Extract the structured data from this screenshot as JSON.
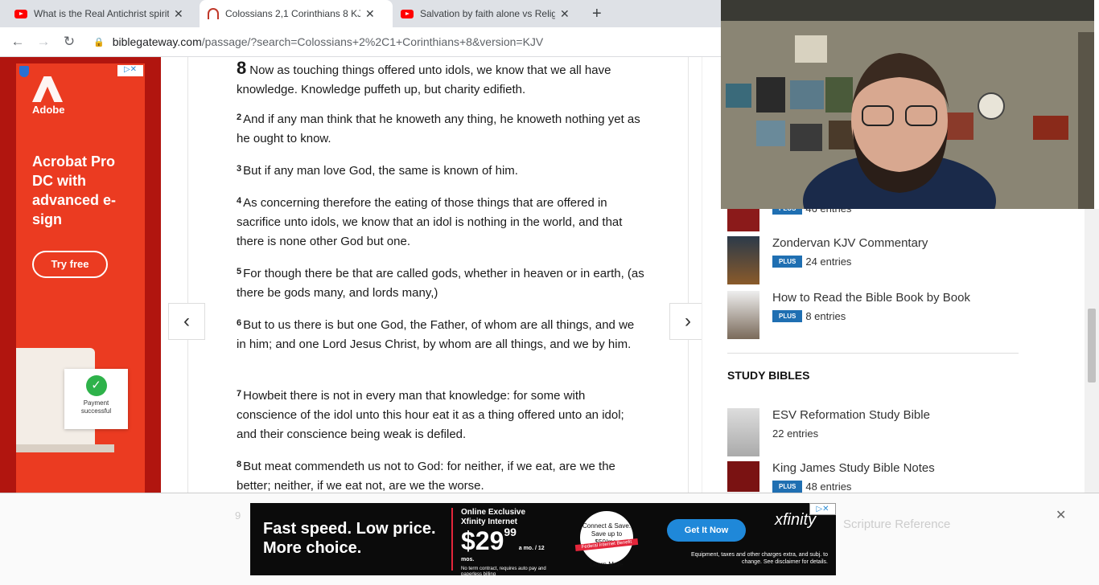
{
  "browser": {
    "tabs": [
      {
        "title": "What is the Real Antichrist spirit",
        "icon": "youtube-icon",
        "active": false
      },
      {
        "title": "Colossians 2,1 Corinthians 8 KJV",
        "icon": "biblegateway-icon",
        "active": true
      },
      {
        "title": "Salvation by faith alone vs Religi",
        "icon": "youtube-icon",
        "active": false
      }
    ],
    "url_host": "biblegateway.com",
    "url_path": "/passage/?search=Colossians+2%2C1+Corinthians+8&version=KJV"
  },
  "left_ad": {
    "brand": "Adobe",
    "headline": "Acrobat Pro DC with advanced e-sign",
    "cta": "Try free",
    "card_text": "Payment successful",
    "colors": {
      "background": "#eb3b21"
    }
  },
  "passage": {
    "chapter": "8",
    "verses": [
      {
        "num": "8",
        "text": "Now as touching things offered unto idols, we know that we all have knowledge. Knowledge puffeth up, but charity edifieth."
      },
      {
        "num": "2",
        "text": "And if any man think that he knoweth any thing, he knoweth nothing yet as he ought to know."
      },
      {
        "num": "3",
        "text": "But if any man love God, the same is known of him."
      },
      {
        "num": "4",
        "text": "As concerning therefore the eating of those things that are offered in sacrifice unto idols, we know that an idol is nothing in the world, and that there is none other God but one."
      },
      {
        "num": "5",
        "text": "For though there be that are called gods, whether in heaven or in earth, (as there be gods many, and lords many,)"
      },
      {
        "num": "6",
        "text": "But to us there is but one God, the Father, of whom are all things, and we in him; and one Lord Jesus Christ, by whom are all things, and we by him."
      },
      {
        "num": "7",
        "text": "Howbeit there is not in every man that knowledge: for some with conscience of the idol unto this hour eat it as a thing offered unto an idol; and their conscience being weak is defiled."
      },
      {
        "num": "8",
        "text": "But meat commendeth us not to God: for neither, if we eat, are we the better; neither, if we eat not, are we the worse."
      }
    ]
  },
  "sidebar": {
    "resources_top": [
      {
        "title": "",
        "badge": "PLUS",
        "entries": "46 entries"
      },
      {
        "title": "Zondervan KJV Commentary",
        "badge": "PLUS",
        "entries": "24 entries"
      },
      {
        "title": "How to Read the Bible Book by Book",
        "badge": "PLUS",
        "entries": "8 entries"
      }
    ],
    "study_bibles_heading": "STUDY BIBLES",
    "study_bibles": [
      {
        "title": "ESV Reformation Study Bible",
        "badge": "",
        "entries": "22 entries"
      },
      {
        "title": "King James Study Bible Notes",
        "badge": "PLUS",
        "entries": "48 entries"
      }
    ],
    "faded_item": "Scripture Reference"
  },
  "bottom_ad": {
    "headline": "Fast speed. Low price. More choice.",
    "offer_line1": "Online Exclusive",
    "offer_line2": "Xfinity Internet",
    "price": "$29",
    "price_cents": "99",
    "price_unit": "a mo. / 12 mos.",
    "terms": "No term contract, requires auto pay and paperless billing",
    "badge_text": "Connect & Save. Save up to $50/mo.",
    "badge_ribbon": "Federal Internet Benefit",
    "badge_footer": "Learn More",
    "cta": "Get It Now",
    "logo": "xfinity",
    "disclaimer": "Equipment, taxes and other charges extra, and subj. to change. See disclaimer for details."
  }
}
